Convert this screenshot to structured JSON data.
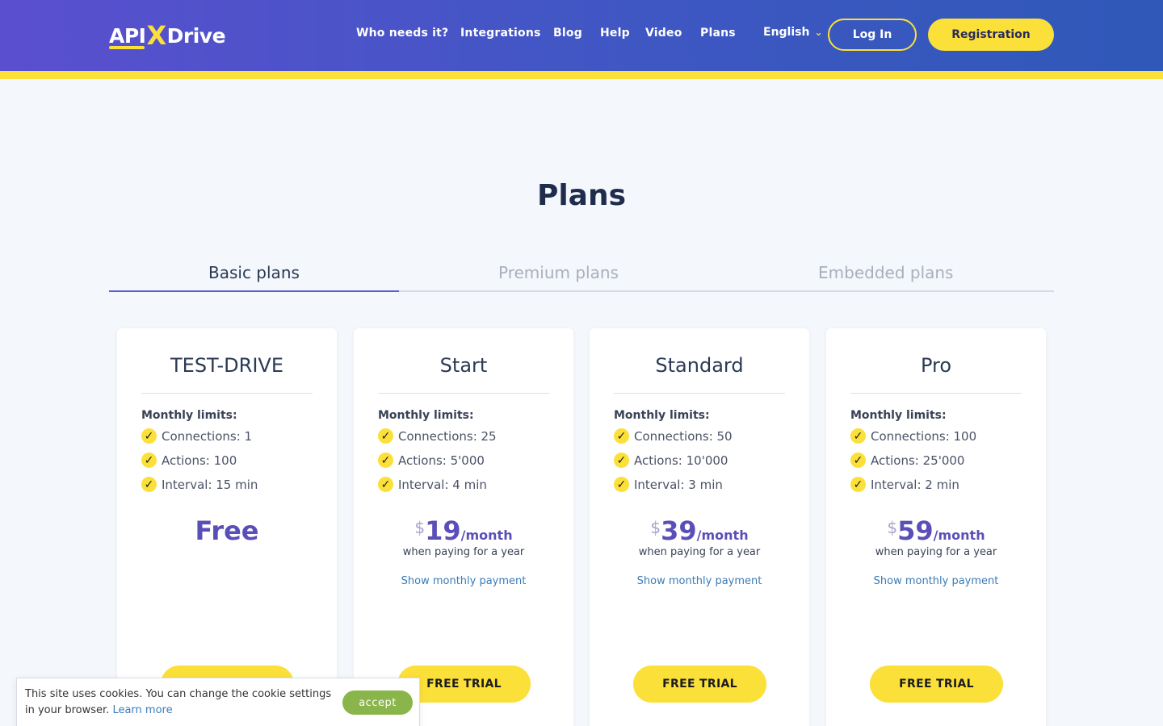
{
  "header": {
    "logo": {
      "part1": "API",
      "part2": "X",
      "part3": "Drive"
    },
    "nav": [
      {
        "label": "Who needs it?"
      },
      {
        "label": "Integrations"
      },
      {
        "label": "Blog"
      },
      {
        "label": "Help"
      },
      {
        "label": "Video"
      },
      {
        "label": "Plans"
      }
    ],
    "language": "English",
    "login_label": "Log In",
    "register_label": "Registration"
  },
  "page_title": "Plans",
  "tabs": [
    {
      "label": "Basic plans",
      "active": true
    },
    {
      "label": "Premium plans",
      "active": false
    },
    {
      "label": "Embedded plans",
      "active": false
    }
  ],
  "plans": [
    {
      "name": "TEST-DRIVE",
      "limits_title": "Monthly limits:",
      "limits": [
        "Connections: 1",
        "Actions: 100",
        "Interval: 15 min"
      ],
      "price_label": "Free",
      "button_label": "FREE TRIAL"
    },
    {
      "name": "Start",
      "limits_title": "Monthly limits:",
      "limits": [
        "Connections: 25",
        "Actions: 5'000",
        "Interval: 4 min"
      ],
      "currency": "$",
      "price": "19",
      "period": "/month",
      "note": "when paying for a year",
      "monthly_link": "Show monthly payment",
      "button_label": "FREE TRIAL"
    },
    {
      "name": "Standard",
      "limits_title": "Monthly limits:",
      "limits": [
        "Connections: 50",
        "Actions: 10'000",
        "Interval: 3 min"
      ],
      "currency": "$",
      "price": "39",
      "period": "/month",
      "note": "when paying for a year",
      "monthly_link": "Show monthly payment",
      "button_label": "FREE TRIAL"
    },
    {
      "name": "Pro",
      "limits_title": "Monthly limits:",
      "limits": [
        "Connections: 100",
        "Actions: 25'000",
        "Interval: 2 min"
      ],
      "currency": "$",
      "price": "59",
      "period": "/month",
      "note": "when paying for a year",
      "monthly_link": "Show monthly payment",
      "button_label": "FREE TRIAL"
    }
  ],
  "cookie": {
    "text": "This site uses cookies. You can change the cookie settings in your browser.",
    "learn_more": "Learn more",
    "accept_label": "accept"
  },
  "colors": {
    "header_gradient_start": "#5a4fcf",
    "header_gradient_end": "#2f58b8",
    "accent_yellow": "#fbe03a",
    "price_purple": "#5a4fb8",
    "link_blue": "#3a7cb8",
    "accept_green": "#8ab54a"
  }
}
